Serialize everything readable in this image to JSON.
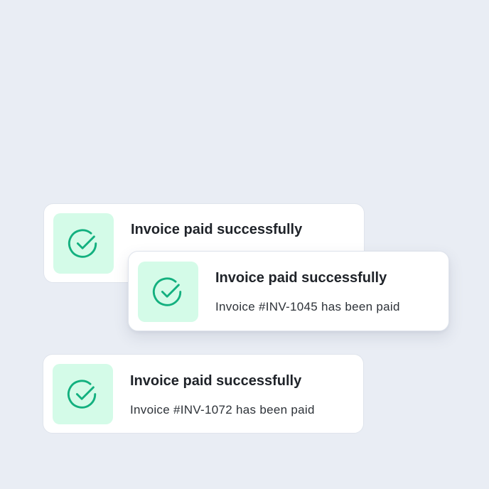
{
  "colors": {
    "background": "#e9edf4",
    "card": "#ffffff",
    "icon_tile": "#d4fbe8",
    "icon_stroke": "#13b07f",
    "title_text": "#1f2329",
    "message_text": "#2d3238"
  },
  "notifications": [
    {
      "title": "Invoice paid successfully",
      "message": "",
      "icon": "check-circle-icon"
    },
    {
      "title": "Invoice paid successfully",
      "message": "Invoice #INV-1045 has been paid",
      "icon": "check-circle-icon"
    },
    {
      "title": "Invoice paid successfully",
      "message": "Invoice #INV-1072 has been paid",
      "icon": "check-circle-icon"
    }
  ]
}
